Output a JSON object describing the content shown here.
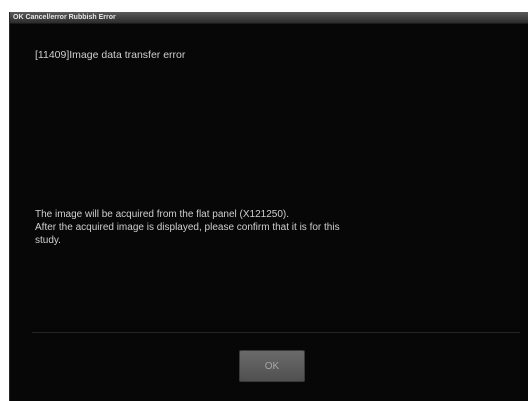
{
  "window": {
    "title": "OK Cancel/error Rubbish Error"
  },
  "error": {
    "code_line": "[11409]Image data transfer error"
  },
  "message": {
    "line1": "The image will be acquired from the flat panel (X121250).",
    "line2": "After the acquired image is displayed, please confirm that it is for this",
    "line3": "study."
  },
  "buttons": {
    "ok_label": "OK"
  },
  "colors": {
    "background": "#070707",
    "text": "#cfcfcf",
    "button": "#5c5c5c"
  }
}
